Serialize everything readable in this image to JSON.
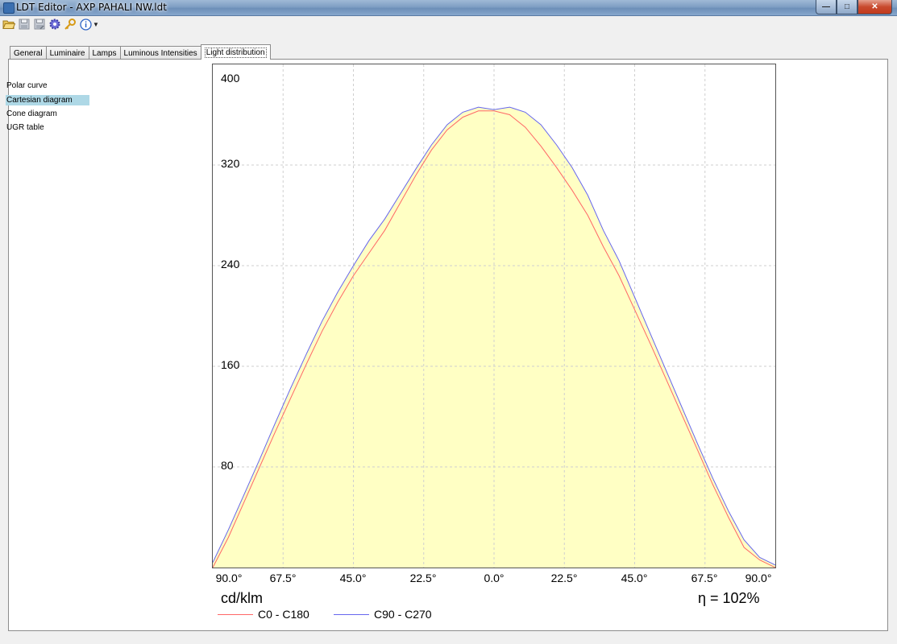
{
  "window": {
    "title": "LDT Editor - AXP PAHALI NW.ldt",
    "controls": {
      "minimize": "—",
      "maximize": "□",
      "close": "✕"
    }
  },
  "toolbar": {
    "icons": [
      "open-folder-icon",
      "save-icon",
      "save-as-icon",
      "settings-icon",
      "key-icon",
      "info-icon"
    ]
  },
  "tabs": [
    {
      "label": "General",
      "active": false
    },
    {
      "label": "Luminaire",
      "active": false
    },
    {
      "label": "Lamps",
      "active": false
    },
    {
      "label": "Luminous Intensities",
      "active": false
    },
    {
      "label": "Light distribution",
      "active": true
    }
  ],
  "nav": {
    "items": [
      {
        "label": "Polar curve",
        "selected": false
      },
      {
        "label": "Cartesian diagram",
        "selected": true
      },
      {
        "label": "Cone diagram",
        "selected": false
      },
      {
        "label": "UGR table",
        "selected": false
      }
    ]
  },
  "chart": {
    "unit_label": "cd/klm",
    "efficiency_label": "η = 102%",
    "y_ticks": [
      "400",
      "320",
      "240",
      "160",
      "80"
    ],
    "x_ticks": [
      "90.0°",
      "67.5°",
      "45.0°",
      "22.5°",
      "0.0°",
      "22.5°",
      "45.0°",
      "67.5°",
      "90.0°"
    ],
    "legend": [
      {
        "label": "C0 - C180",
        "color": "#ff6666"
      },
      {
        "label": "C90 - C270",
        "color": "#6666ee"
      }
    ]
  },
  "chart_data": {
    "type": "area",
    "x": [
      -90,
      -85,
      -80,
      -75,
      -70,
      -65,
      -60,
      -55,
      -50,
      -45,
      -40,
      -35,
      -30,
      -25,
      -20,
      -15,
      -10,
      -5,
      0,
      5,
      10,
      15,
      20,
      25,
      30,
      35,
      40,
      45,
      50,
      55,
      60,
      65,
      70,
      75,
      80,
      85,
      90
    ],
    "ylim": [
      0,
      400
    ],
    "xlim": [
      -90,
      90
    ],
    "grid": true,
    "fill_color": "#ffffc4",
    "series": [
      {
        "name": "C0 - C180",
        "color": "#ff6666",
        "values": [
          0,
          24,
          52,
          80,
          108,
          135,
          162,
          188,
          211,
          232,
          250,
          268,
          290,
          312,
          332,
          348,
          358,
          363,
          363,
          360,
          350,
          335,
          318,
          300,
          280,
          255,
          232,
          205,
          178,
          150,
          122,
          94,
          66,
          40,
          16,
          6,
          0
        ]
      },
      {
        "name": "C90 - C270",
        "color": "#6666ee",
        "values": [
          4,
          30,
          58,
          86,
          115,
          143,
          170,
          196,
          219,
          240,
          260,
          277,
          297,
          317,
          336,
          352,
          362,
          366,
          364,
          366,
          362,
          352,
          336,
          318,
          296,
          268,
          244,
          215,
          186,
          157,
          128,
          99,
          71,
          45,
          22,
          8,
          2
        ]
      }
    ],
    "legend": "bottom-left"
  }
}
